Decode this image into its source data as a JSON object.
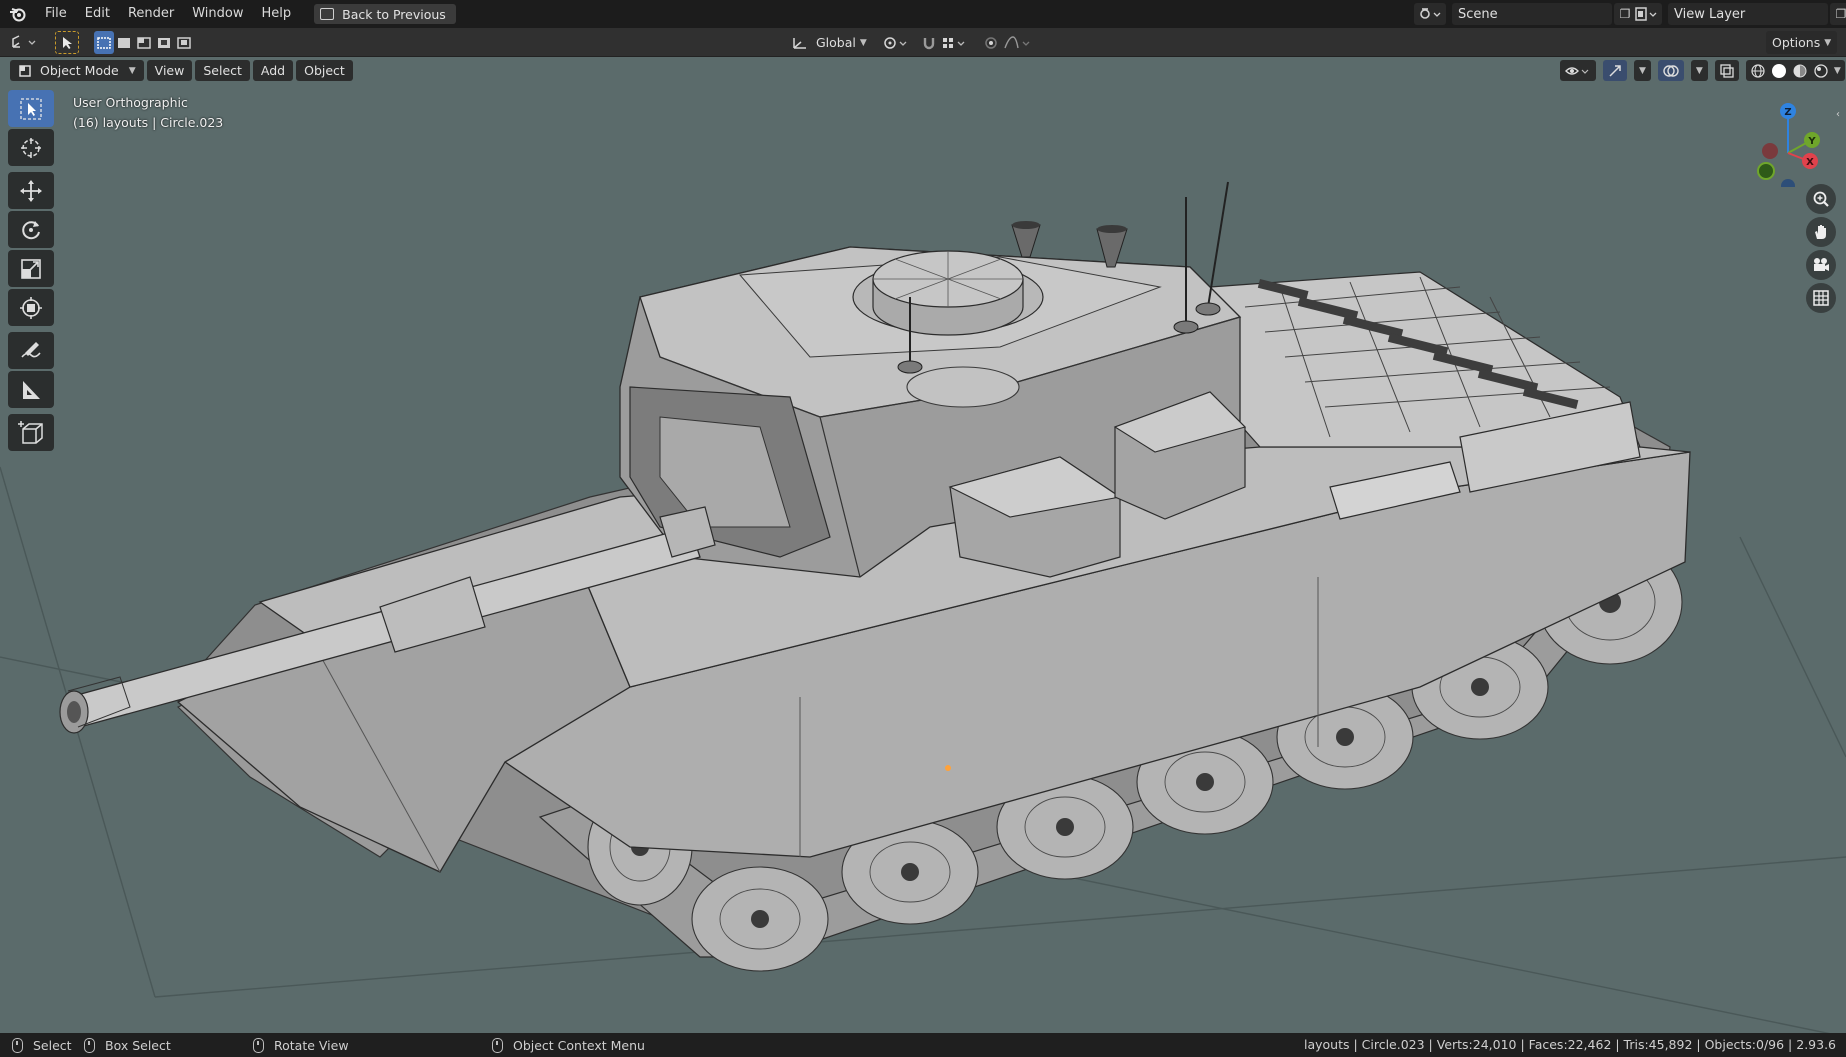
{
  "menubar": {
    "app_icon": "blender-logo-icon",
    "items": [
      "File",
      "Edit",
      "Render",
      "Window",
      "Help"
    ],
    "back_button": "Back to Previous",
    "scene_label": "Scene",
    "view_layer_label": "View Layer"
  },
  "toolbar": {
    "editor_type_icon": "3d-viewport-icon",
    "transform_orientation": "Global",
    "options_label": "Options"
  },
  "viewport_header": {
    "mode": "Object Mode",
    "menus": [
      "View",
      "Select",
      "Add",
      "Object"
    ]
  },
  "view_info": {
    "projection": "User Orthographic",
    "collection_object": "(16) layouts | Circle.023"
  },
  "tools": [
    {
      "name": "select-box-tool",
      "icon": "cursor-arrow-icon",
      "active": true
    },
    {
      "name": "cursor-tool",
      "icon": "3d-cursor-icon",
      "active": false
    },
    {
      "name": "move-tool",
      "icon": "move-arrows-icon",
      "active": false
    },
    {
      "name": "rotate-tool",
      "icon": "rotate-icon",
      "active": false
    },
    {
      "name": "scale-tool",
      "icon": "scale-icon",
      "active": false
    },
    {
      "name": "transform-tool",
      "icon": "transform-icon",
      "active": false
    },
    {
      "name": "annotate-tool",
      "icon": "pencil-icon",
      "active": false
    },
    {
      "name": "measure-tool",
      "icon": "ruler-icon",
      "active": false
    },
    {
      "name": "add-cube-tool",
      "icon": "add-cube-icon",
      "active": false
    }
  ],
  "gizmo": {
    "z": "Z",
    "y": "Y",
    "x": "X"
  },
  "statusbar": {
    "select": "Select",
    "box_select": "Box Select",
    "rotate_view": "Rotate View",
    "context_menu": "Object Context Menu",
    "stats": "layouts | Circle.023 | Verts:24,010 | Faces:22,462 | Tris:45,892 | Objects:0/96 | 2.93.6"
  },
  "colors": {
    "viewport_bg": "#5b6b6b",
    "active_blue": "#4772b3",
    "axis_x": "#e0424c",
    "axis_y": "#6fa62b",
    "axis_z": "#2f83e0"
  }
}
